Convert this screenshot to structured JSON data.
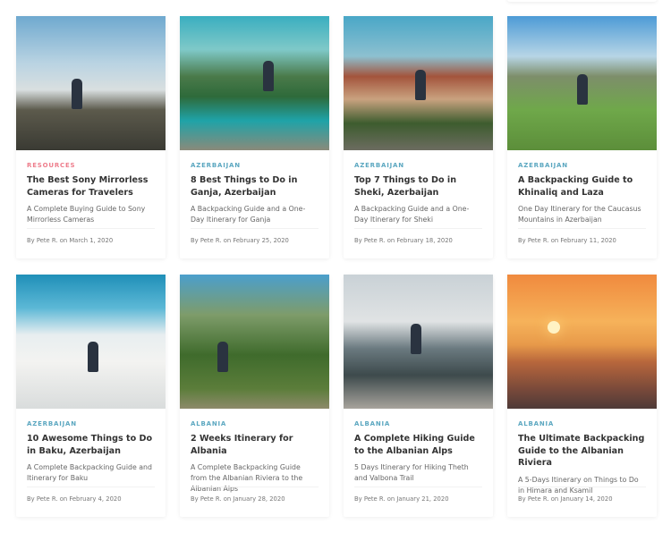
{
  "posts": [
    {
      "category": "RESOURCES",
      "title": "The Best Sony Mirrorless Cameras for Travelers",
      "subtitle": "A Complete Buying Guide to Sony Mirrorless Cameras",
      "meta": "By Pete R. on March 1, 2020",
      "category_color": "#ee7d8c"
    },
    {
      "category": "AZERBAIJAN",
      "title": "8 Best Things to Do in Ganja, Azerbaijan",
      "subtitle": "A Backpacking Guide and a One-Day Itinerary for Ganja",
      "meta": "By Pete R. on February 25, 2020",
      "category_color": "#5ba7c0"
    },
    {
      "category": "AZERBAIJAN",
      "title": "Top 7 Things to Do in Sheki, Azerbaijan",
      "subtitle": "A Backpacking Guide and a One-Day Itinerary for Sheki",
      "meta": "By Pete R. on February 18, 2020",
      "category_color": "#5ba7c0"
    },
    {
      "category": "AZERBAIJAN",
      "title": "A Backpacking Guide to Khinaliq and Laza",
      "subtitle": "One Day Itinerary for the Caucasus Mountains in Azerbaijan",
      "meta": "By Pete R. on February 11, 2020",
      "category_color": "#5ba7c0"
    },
    {
      "category": "AZERBAIJAN",
      "title": "10 Awesome Things to Do in Baku, Azerbaijan",
      "subtitle": "A Complete Backpacking Guide and Itinerary for Baku",
      "meta": "By Pete R. on February 4, 2020",
      "category_color": "#5ba7c0"
    },
    {
      "category": "ALBANIA",
      "title": "2 Weeks Itinerary for Albania",
      "subtitle": "A Complete Backpacking Guide from the Albanian Riviera to the Albanian Alps",
      "meta": "By Pete R. on January 28, 2020",
      "category_color": "#5ba7c0"
    },
    {
      "category": "ALBANIA",
      "title": "A Complete Hiking Guide to the Albanian Alps",
      "subtitle": "5 Days Itinerary for Hiking Theth and Valbona Trail",
      "meta": "By Pete R. on January 21, 2020",
      "category_color": "#5ba7c0"
    },
    {
      "category": "ALBANIA",
      "title": "The Ultimate Backpacking Guide to the Albanian Riviera",
      "subtitle": "A 5-Days Itinerary on Things to Do in Himara and Ksamil",
      "meta": "By Pete R. on January 14, 2020",
      "category_color": "#5ba7c0"
    }
  ]
}
